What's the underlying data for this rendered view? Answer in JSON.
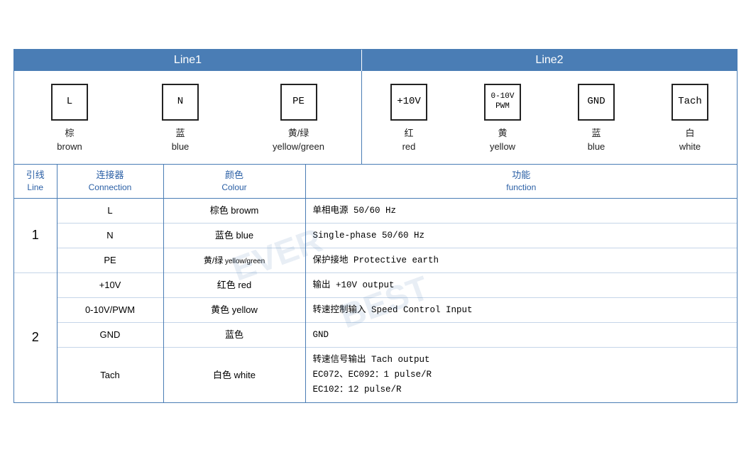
{
  "header": {
    "line1": "Line1",
    "line2": "Line2"
  },
  "diagram": {
    "line1_connectors": [
      {
        "id": "L",
        "label": "L",
        "zh": "棕",
        "en": "brown"
      },
      {
        "id": "N",
        "label": "N",
        "zh": "蓝",
        "en": "blue"
      },
      {
        "id": "PE",
        "label": "PE",
        "zh": "黄/绿",
        "en": "yellow/green"
      }
    ],
    "line2_connectors": [
      {
        "id": "10V",
        "label": "+10V",
        "zh": "红",
        "en": "red"
      },
      {
        "id": "PWM",
        "label": "0-10V\nPWM",
        "zh": "黄",
        "en": "yellow"
      },
      {
        "id": "GND",
        "label": "GND",
        "zh": "蓝",
        "en": "blue"
      },
      {
        "id": "Tach",
        "label": "Tach",
        "zh": "白",
        "en": "white"
      }
    ]
  },
  "table": {
    "headers": {
      "line_zh": "引线",
      "line_en": "Line",
      "conn_zh": "连接器",
      "conn_en": "Connection",
      "colour_zh": "颜色",
      "colour_en": "Colour",
      "func_zh": "功能",
      "func_en": "function"
    },
    "rows": [
      {
        "group": "1",
        "rowspan": 3,
        "connection": "L",
        "colour": "棕色 browm",
        "function": "单相电源 50/60 Hz"
      },
      {
        "group": null,
        "connection": "N",
        "colour": "蓝色 blue",
        "function": "Single-phase 50/60 Hz"
      },
      {
        "group": null,
        "connection": "PE",
        "colour": "黄/绿 yellow/green",
        "colour_small": true,
        "function": "保护接地 Protective earth"
      },
      {
        "group": "2",
        "rowspan": 4,
        "connection": "+10V",
        "colour": "红色 red",
        "function": "输出 +10V output"
      },
      {
        "group": null,
        "connection": "0-10V/PWM",
        "colour": "黄色 yellow",
        "function": "转速控制输入 Speed Control Input"
      },
      {
        "group": null,
        "connection": "GND",
        "colour": "蓝色",
        "function": "GND"
      },
      {
        "group": null,
        "connection": "Tach",
        "colour": "白色 white",
        "function": "转速信号输出 Tach output\nEC072、EC092：1 pulse/R\nEC102：12 pulse/R"
      }
    ]
  }
}
